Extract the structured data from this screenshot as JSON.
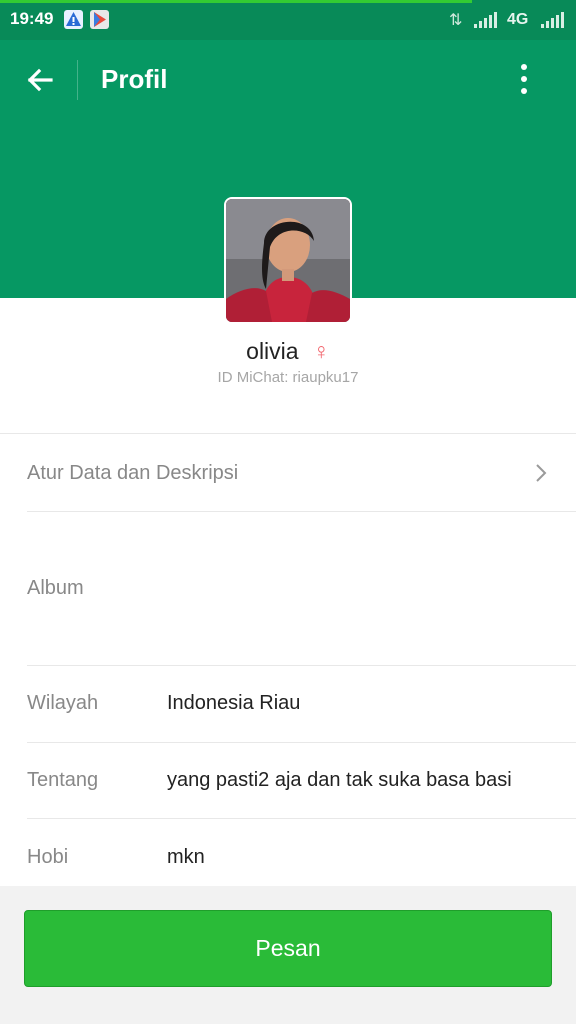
{
  "status_bar": {
    "time": "19:49",
    "network": "4G",
    "notification_icons": [
      "warning-notification-icon",
      "play-store-icon"
    ]
  },
  "header": {
    "title": "Profil",
    "background_color": "#069863"
  },
  "profile": {
    "name": "olivia",
    "gender_symbol": "♀",
    "id_line": "ID MiChat: riaupku17"
  },
  "rows": {
    "settings_label": "Atur Data dan Deskripsi",
    "album_label": "Album",
    "region_label": "Wilayah",
    "region_value": "Indonesia Riau",
    "about_label": "Tentang",
    "about_value": "yang pasti2 aja  dan tak suka basa basi",
    "hobby_label": "Hobi",
    "hobby_value": "mkn"
  },
  "footer": {
    "message_button": "Pesan",
    "button_color": "#2abb38"
  }
}
